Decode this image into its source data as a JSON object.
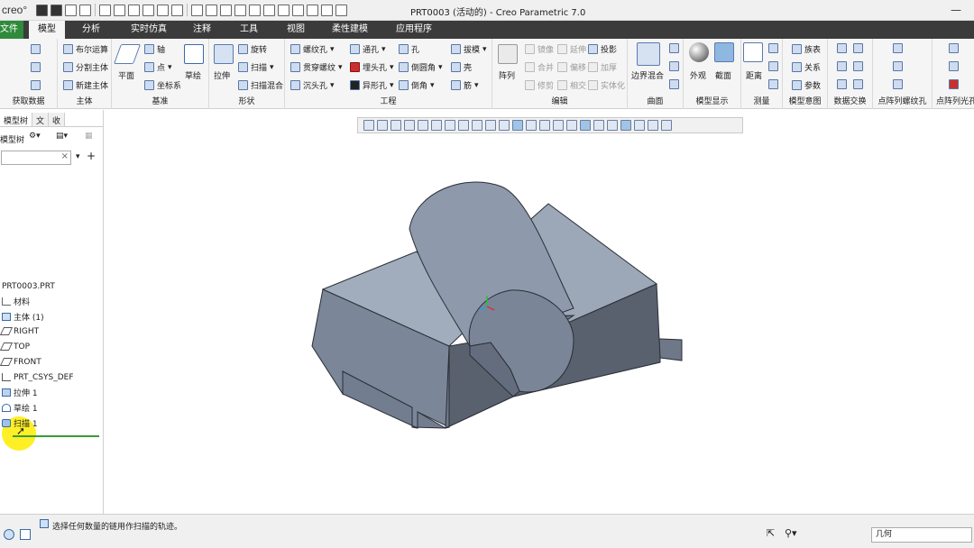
{
  "app": {
    "logo": "creo°",
    "title": "PRT0003 (活动的) - Creo Parametric 7.0"
  },
  "tabs": [
    {
      "label": "文件"
    },
    {
      "label": "模型"
    },
    {
      "label": "分析"
    },
    {
      "label": "实时仿真"
    },
    {
      "label": "注释"
    },
    {
      "label": "工具"
    },
    {
      "label": "视图"
    },
    {
      "label": "柔性建模"
    },
    {
      "label": "应用程序"
    }
  ],
  "ribbon": {
    "groups": {
      "get_data": "获取数据",
      "body": "主体",
      "datum": "基准",
      "shapes": "形状",
      "engineering": "工程",
      "editing": "编辑",
      "surfaces": "曲面",
      "model_display": "模型显示",
      "measure": "测量",
      "model_intent": "模型意图",
      "data_exchange": "数据交换",
      "pattern_hole": "点阵列螺纹孔",
      "pattern_light": "点阵列光孔"
    },
    "body": {
      "boolean": "布尔运算",
      "split": "分割主体",
      "new": "新建主体"
    },
    "datum": {
      "plane": "平面",
      "axis": "轴",
      "point": "点",
      "csys": "坐标系",
      "sketch": "草绘"
    },
    "shapes": {
      "extrude": "拉伸",
      "revolve": "旋转",
      "sweep": "扫描",
      "swept_blend": "扫描混合"
    },
    "engineering": {
      "thread_hole": "螺纹孔",
      "through_thread": "贯穿螺纹",
      "counterbore": "沉头孔",
      "through_hole": "通孔",
      "tapped_hole": "埋头孔",
      "shaped_hole": "异形孔",
      "hole": "孔",
      "round": "倒圆角",
      "chamfer": "倒角",
      "draft": "拔模",
      "shell": "壳",
      "rib": "筋"
    },
    "editing": {
      "pattern": "阵列",
      "mirror": "镜像",
      "merge": "合并",
      "trim": "修剪",
      "extend": "延伸",
      "offset": "偏移",
      "intersect": "相交",
      "project": "投影",
      "thicken": "加厚",
      "solidify": "实体化"
    },
    "surfaces": {
      "boundary_blend": "边界混合"
    },
    "model_display": {
      "appearance": "外观",
      "section": "截面"
    },
    "measure": {
      "distance": "距离"
    },
    "model_intent": {
      "family_table": "族表",
      "relations": "关系",
      "parameters": "参数"
    }
  },
  "panel": {
    "tabs": [
      "模型树",
      "文",
      "收"
    ],
    "tree_header": "模型树",
    "search_value": "",
    "tree": [
      {
        "label": "PRT0003.PRT",
        "icon": "part-icon"
      },
      {
        "label": "材料",
        "icon": "material-icon"
      },
      {
        "label": "主体 (1)",
        "icon": "body-icon"
      },
      {
        "label": "RIGHT",
        "icon": "datum-plane-icon"
      },
      {
        "label": "TOP",
        "icon": "datum-plane-icon"
      },
      {
        "label": "FRONT",
        "icon": "datum-plane-icon"
      },
      {
        "label": "PRT_CSYS_DEF",
        "icon": "csys-icon"
      },
      {
        "label": "拉伸 1",
        "icon": "extrude-icon"
      },
      {
        "label": "草绘 1",
        "icon": "sketch-icon"
      },
      {
        "label": "扫描 1",
        "icon": "sweep-icon"
      }
    ]
  },
  "status": {
    "message": "选择任何数量的链用作扫描的轨迹。",
    "filter_value": "几何"
  },
  "colors": {
    "titlebar": "#f0f0f0",
    "tabbar": "#3b3b3b",
    "file_tab": "#2f8a3a",
    "model_face_top": "#98a3b3",
    "model_face_front": "#7a8597",
    "model_face_side": "#5f6878",
    "cursor_highlight": "#ffec00"
  }
}
